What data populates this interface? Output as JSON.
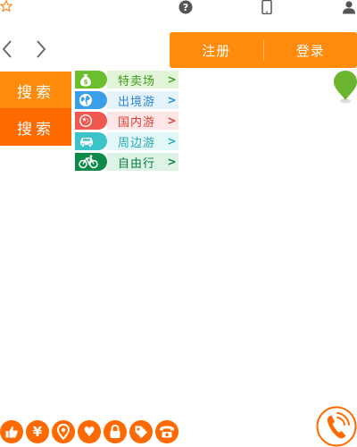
{
  "top_bar": {
    "icons": [
      "star-outline-icon",
      "help-circle-icon",
      "mobile-phone-icon",
      "user-icon"
    ]
  },
  "nav": {
    "prev_icon": "chevron-left-icon",
    "next_icon": "chevron-right-icon"
  },
  "auth": {
    "register_label": "注册",
    "login_label": "登录"
  },
  "search": {
    "primary_label": "搜索",
    "secondary_label": "搜索"
  },
  "categories": [
    {
      "label": "特卖场",
      "icon": "money-bag-icon",
      "icon_color": "#6cbf2c",
      "bg_color": "#e3f5d9",
      "text_color": "#3f9a1b"
    },
    {
      "label": "出境游",
      "icon": "globe-icon",
      "icon_color": "#3a9fe8",
      "bg_color": "#e5f3fd",
      "text_color": "#2c86cf"
    },
    {
      "label": "国内游",
      "icon": "china-flag-icon",
      "icon_color": "#f0574f",
      "bg_color": "#fde6e5",
      "text_color": "#d9423b"
    },
    {
      "label": "周边游",
      "icon": "car-icon",
      "icon_color": "#3cc3c9",
      "bg_color": "#e2f7f8",
      "text_color": "#27a9af"
    },
    {
      "label": "自由行",
      "icon": "bicycle-icon",
      "icon_color": "#0d8a48",
      "bg_color": "#dcf3e6",
      "text_color": "#0c7a3f"
    }
  ],
  "map": {
    "pin_icon": "map-pin-icon",
    "pin_color": "#6ab42e"
  },
  "bottom_icons": [
    "thumbs-up-icon",
    "yen-icon",
    "location-pin-icon",
    "heart-icon",
    "lock-icon",
    "tag-icon",
    "telephone-icon"
  ],
  "bottom_glyphs": [
    "",
    "¥",
    "",
    "♥",
    "",
    "",
    ""
  ],
  "call_button": {
    "icon": "phone-call-icon",
    "color": "#ff6a00"
  },
  "colors": {
    "accent": "#ff8a0c",
    "accent_dark": "#ff6a00"
  }
}
